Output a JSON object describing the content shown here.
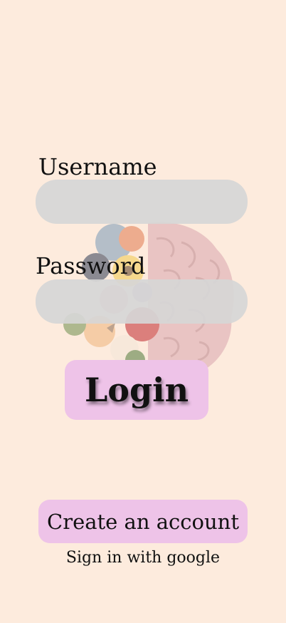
{
  "form": {
    "username_label": "Username",
    "username_value": "",
    "password_label": "Password",
    "password_value": ""
  },
  "actions": {
    "login_label": "Login",
    "create_account_label": "Create an account",
    "google_signin_label": "Sign in with google"
  },
  "colors": {
    "background": "#FDEBDD",
    "field": "#D6D6D6",
    "button": "#EEC3E8"
  },
  "illustration": {
    "name": "floral-brain-illustration"
  }
}
